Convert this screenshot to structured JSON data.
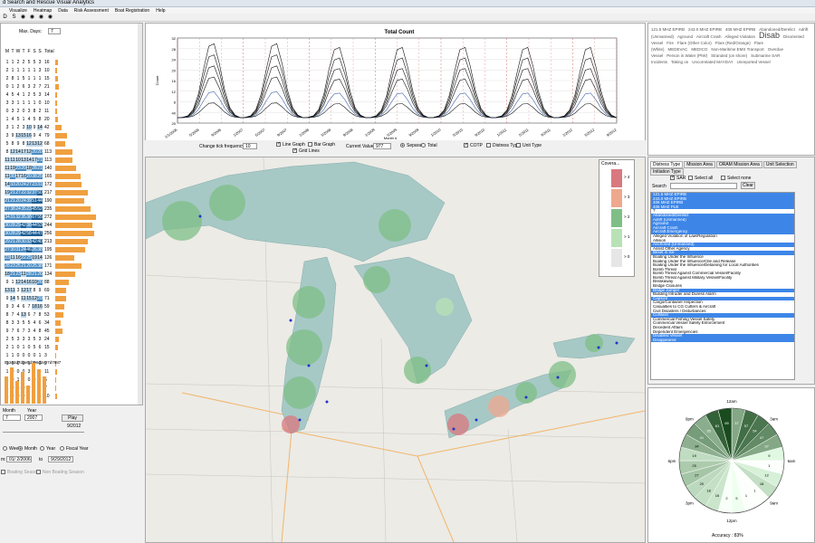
{
  "app": {
    "title": "d Search and Rescue Visual Analytics"
  },
  "menu": [
    "",
    "Visualize",
    "Heatmap",
    "Data",
    "Risk Assessment",
    "Boat Registration",
    "Help"
  ],
  "toolbar": {
    "icons": [
      "D",
      "S",
      "",
      "",
      "",
      ""
    ]
  },
  "left": {
    "max_days_label": "Max. Days:",
    "max_days_value": "7",
    "headers": [
      "M",
      "T",
      "W",
      "T",
      "F",
      "S",
      "S",
      "Total"
    ],
    "rows": [
      [
        0,
        0,
        0,
        0,
        0,
        0,
        0,
        0
      ],
      [
        1,
        1,
        2,
        2,
        5,
        5,
        3,
        16
      ],
      [
        2,
        1,
        1,
        1,
        1,
        1,
        3,
        10
      ],
      [
        2,
        8,
        1,
        5,
        1,
        1,
        1,
        15
      ],
      [
        0,
        1,
        2,
        6,
        3,
        2,
        7,
        21
      ],
      [
        4,
        5,
        4,
        1,
        2,
        5,
        3,
        14
      ],
      [
        3,
        3,
        1,
        1,
        1,
        1,
        0,
        10
      ],
      [
        0,
        3,
        2,
        0,
        3,
        8,
        2,
        11
      ],
      [
        1,
        4,
        5,
        1,
        4,
        5,
        8,
        20
      ],
      [
        3,
        1,
        2,
        3,
        10,
        9,
        14,
        42
      ],
      [
        3,
        9,
        13,
        15,
        16,
        9,
        4,
        79
      ],
      [
        5,
        8,
        9,
        8,
        12,
        13,
        12,
        68
      ],
      [
        8,
        12,
        14,
        17,
        12,
        20,
        20,
        113
      ],
      [
        11,
        11,
        10,
        13,
        14,
        17,
        21,
        113
      ],
      [
        11,
        19,
        23,
        20,
        18,
        28,
        21,
        140
      ],
      [
        11,
        30,
        17,
        16,
        20,
        38,
        25,
        165
      ],
      [
        14,
        33,
        20,
        24,
        27,
        23,
        31,
        172
      ],
      [
        19,
        21,
        27,
        22,
        32,
        37,
        50,
        217
      ],
      [
        21,
        21,
        20,
        24,
        39,
        51,
        44,
        190
      ],
      [
        27,
        38,
        24,
        35,
        23,
        45,
        52,
        235
      ],
      [
        34,
        31,
        32,
        35,
        38,
        67,
        55,
        272
      ],
      [
        30,
        28,
        29,
        42,
        38,
        44,
        53,
        244
      ],
      [
        30,
        28,
        29,
        42,
        58,
        44,
        47,
        256
      ],
      [
        29,
        21,
        28,
        30,
        33,
        42,
        40,
        213
      ],
      [
        27,
        30,
        31,
        24,
        46,
        26,
        38,
        195
      ],
      [
        23,
        11,
        16,
        22,
        25,
        19,
        14,
        126
      ],
      [
        28,
        23,
        25,
        21,
        20,
        25,
        38,
        171
      ],
      [
        18,
        21,
        23,
        11,
        28,
        21,
        26,
        134
      ],
      [
        9,
        1,
        12,
        14,
        16,
        10,
        26,
        88
      ],
      [
        13,
        11,
        3,
        12,
        17,
        8,
        9,
        69
      ],
      [
        9,
        14,
        5,
        11,
        15,
        12,
        29,
        71
      ],
      [
        9,
        3,
        4,
        6,
        7,
        18,
        16,
        59
      ],
      [
        8,
        7,
        4,
        13,
        6,
        7,
        8,
        53
      ],
      [
        8,
        3,
        3,
        5,
        5,
        4,
        6,
        34
      ],
      [
        9,
        7,
        6,
        7,
        3,
        4,
        8,
        45
      ],
      [
        2,
        5,
        3,
        3,
        3,
        5,
        3,
        24
      ],
      [
        2,
        1,
        0,
        1,
        0,
        5,
        6,
        15
      ],
      [
        1,
        1,
        0,
        0,
        0,
        0,
        1,
        3
      ],
      [
        1,
        0,
        0,
        0,
        1,
        0,
        0,
        2
      ],
      [
        1,
        0,
        0,
        0,
        3,
        1,
        5,
        11
      ],
      [
        1,
        0,
        1,
        1,
        0,
        0,
        1,
        5
      ],
      [
        1,
        0,
        3,
        0,
        0,
        2,
        1,
        7
      ],
      [
        1,
        0,
        0,
        0,
        2,
        1,
        3,
        10
      ]
    ],
    "totals_row": "552e2d7d3e5d2e6d2ex7d7987",
    "scrollbar": true
  },
  "leftctrl": {
    "month_label": "Month",
    "year_label": "Year",
    "month_value": "7",
    "year_value": "2007",
    "play_label": "Play",
    "date_label": "9/2012",
    "week_label": "Week",
    "month_radio": "Month",
    "year_radio": "Year",
    "fiscal_label": "Fiscal Year",
    "from_label": "m:",
    "from_value": "01/ 2/2006",
    "to_label": "to",
    "to_value": "9/29/2012",
    "boating_season": "Boating Season",
    "non_boating": "Non Boating Season"
  },
  "chart": {
    "title": "Total Count",
    "ylabel": "Count",
    "xlabel": "Month #",
    "yticks": [
      "32",
      "28",
      "24",
      "20",
      "16",
      "12",
      "8",
      "40",
      "20"
    ],
    "xticks": [
      "1/1/2006",
      "5/2006",
      "9/2006",
      "1/2007",
      "5/2007",
      "9/2007",
      "1/2008",
      "5/2008",
      "9/2008",
      "1/2009",
      "5/2009",
      "9/2009",
      "1/2010",
      "5/2010",
      "9/2010",
      "1/2011",
      "5/2011",
      "9/2011",
      "1/2012",
      "5/2012",
      "9/2012"
    ]
  },
  "controls": {
    "tick_freq_label": "Change tick frequency:",
    "tick_freq_value": "10",
    "line_graph": "Line Graph",
    "bar_graph": "Bar Graph",
    "grid_lines": "Grid Lines",
    "current_value_label": "Current Value:",
    "current_value": "977",
    "separate": "Separate",
    "total": "Total",
    "cotp": "COTP",
    "distress_type": "Distress Type",
    "unit_type": "Unit Type"
  },
  "tagcloud": [
    "121.5 MHZ EPIRB",
    "243.0 MHZ EPIRB",
    "406 MHZ EPIRB",
    "Abandoned/Derelict",
    "Adrift (Unmanned)",
    "Aground",
    "Aircraft Crash",
    "Alleged Violation",
    "Disab",
    "Disoriented Vessel",
    "Fire",
    "Flare (Other Color)",
    "Flare (Red/Orange)",
    "Flare (White)",
    "MEDEVAC",
    "MEDICO",
    "Non-Maritime EMS Transport",
    "Overdue Vessel",
    "Person in Water (PIW)",
    "Stranded (on shore)",
    "Submarine SAR Incidents",
    "Taking on",
    "Uncorrelated MAYDAY",
    "Unreported Vessel"
  ],
  "filter": {
    "tabs": [
      "Distress Type",
      "Mission Area",
      "ORAM Mission Area",
      "Unit Selection",
      "Initiation Type"
    ],
    "sar_label": "SAR",
    "select_all": "Select all",
    "select_none": "Select none",
    "search_label": "Search",
    "clear_label": "Clear",
    "items": [
      {
        "t": "121.5 MHZ EPIRB",
        "s": true
      },
      {
        "t": "243.0 MHZ EPIRB",
        "s": true
      },
      {
        "t": "406 MHZ EPIRB",
        "s": true
      },
      {
        "t": "406 MHZ PLB",
        "s": true
      },
      {
        "t": "?",
        "s": false
      },
      {
        "t": "Abandoned/Derelict",
        "s": true
      },
      {
        "t": "Adrift (Unmanned)",
        "s": true
      },
      {
        "t": "Aground",
        "s": true
      },
      {
        "t": "Aircraft Crash",
        "s": true
      },
      {
        "t": "Aircraft Emergency",
        "s": true
      },
      {
        "t": "Alleged Violation of Law/Regulation",
        "s": false
      },
      {
        "t": "Allision",
        "s": false
      },
      {
        "t": "Anchored (Unmanned)",
        "s": true
      },
      {
        "t": "Assist Other Agency",
        "s": false
      },
      {
        "t": "Beset in Ice",
        "s": true
      },
      {
        "t": "Boating Under the Influence",
        "s": false
      },
      {
        "t": "Boating Under the Influence/Ctle and Release",
        "s": false
      },
      {
        "t": "Boating Under the Influence/Detaining for Local Authorities",
        "s": false
      },
      {
        "t": "Bomb Threat",
        "s": false
      },
      {
        "t": "Bomb Threat Against Commercial Vessel/Facility",
        "s": false
      },
      {
        "t": "Bomb Threat Against Military Vessel/Facility",
        "s": false
      },
      {
        "t": "Breakaway",
        "s": false
      },
      {
        "t": "Bridge Closures",
        "s": false
      },
      {
        "t": "Bridge Jumper",
        "s": true
      },
      {
        "t": "Building Intruder and Duress Alarm",
        "s": false
      },
      {
        "t": "Capsize",
        "s": true
      },
      {
        "t": "Cargo/Container Inspection",
        "s": false
      },
      {
        "t": "Casualties to CG Cutters & Aircraft",
        "s": false
      },
      {
        "t": "Civil Disasters / Disturbances",
        "s": false
      },
      {
        "t": "Collision",
        "s": true
      },
      {
        "t": "Commercial Fishing Vessel Safety",
        "s": false
      },
      {
        "t": "Commercial Vessel Safety Enforcement",
        "s": false
      },
      {
        "t": "Decedent Affairs",
        "s": false
      },
      {
        "t": "Dependent Emergencies",
        "s": false
      },
      {
        "t": "Disabled Vessel",
        "s": true
      },
      {
        "t": "Disappeared",
        "s": true
      }
    ]
  },
  "legend": {
    "title": "Covera...",
    "items": [
      "> 4",
      "> 3",
      "> 2",
      "> 1",
      "> 0"
    ],
    "colors": [
      "#d9787f",
      "#eea88e",
      "#7fbf87",
      "#b8e2b6",
      "#e6e6e6"
    ]
  },
  "clock": {
    "labels": [
      "12am",
      "3am",
      "6am",
      "9am",
      "12pm",
      "3pm",
      "6pm",
      "9pm"
    ],
    "values": [
      37,
      57,
      54,
      47,
      37,
      9,
      1,
      12,
      18,
      1,
      1,
      5,
      2,
      16,
      18,
      20,
      27,
      25,
      19,
      34,
      41,
      35,
      61,
      69
    ],
    "accuracy_label": "Accuracy :",
    "accuracy_value": "83%"
  }
}
